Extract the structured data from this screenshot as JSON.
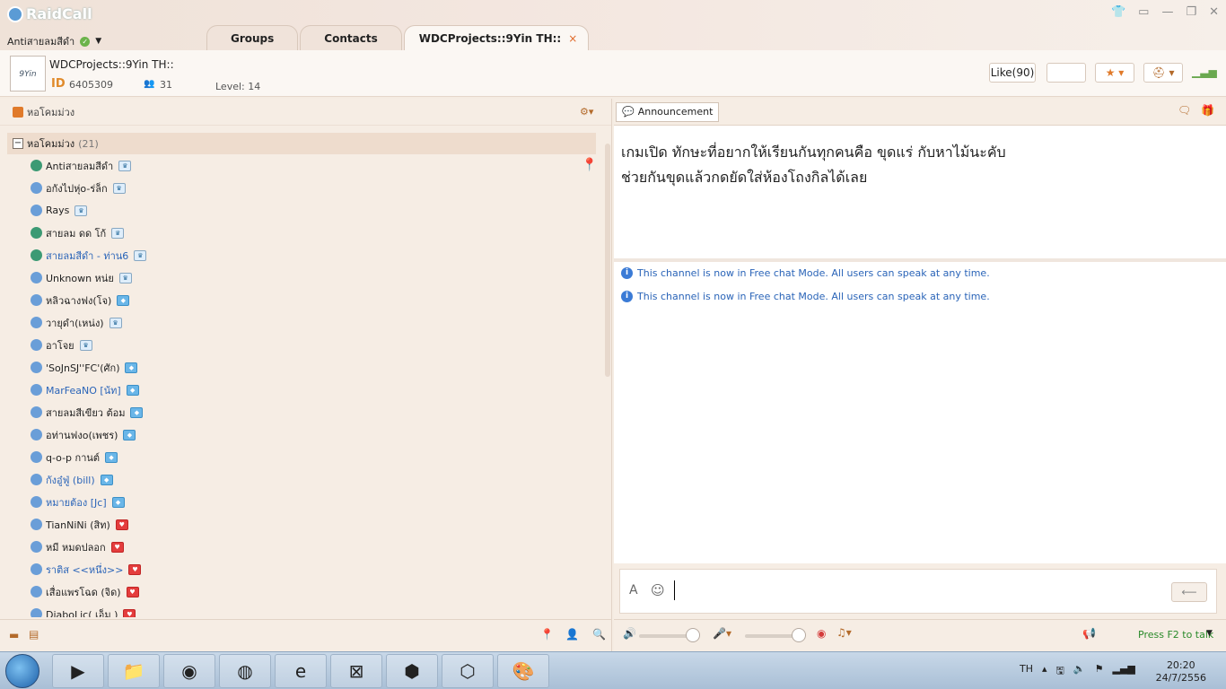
{
  "app": {
    "name": "RaidCall"
  },
  "user": {
    "name": "Antiสายลมสีดำ"
  },
  "tabs": [
    {
      "label": "Groups"
    },
    {
      "label": "Contacts"
    },
    {
      "label": "WDCProjects::9Yin TH::",
      "close": "×"
    }
  ],
  "window_controls": [
    "👕",
    "▭",
    "—",
    "❐",
    "✕"
  ],
  "channel": {
    "avatar_text": "9Yin",
    "name": "WDCProjects::9Yin TH::",
    "id_label": "ID",
    "id": "6405309",
    "member_count": "31",
    "level": "Level: 14"
  },
  "header_buttons": {
    "like": "Like(90)",
    "star": "★ ▾",
    "hat": "⛑ ▾",
    "signal": "▁▃▅"
  },
  "left": {
    "head_label": "หอโคมม่วง",
    "root": {
      "label": "หอโคมม่วง",
      "count": "(21)"
    },
    "members": [
      {
        "name": "Antiสายลมสีดำ",
        "icon": "green",
        "badge": "w",
        "color": "black"
      },
      {
        "name": "อกังไปหุ่o-ร่ล็ก",
        "icon": "blue",
        "badge": "w",
        "color": "black"
      },
      {
        "name": "Rays",
        "icon": "blue",
        "badge": "w",
        "color": "black"
      },
      {
        "name": "สายลม ดด  โก้",
        "icon": "green",
        "badge": "w",
        "color": "black"
      },
      {
        "name": "สายลมสีดำ - ท่าน6",
        "icon": "green",
        "badge": "w",
        "color": "blue"
      },
      {
        "name": "Unknown หน่ย",
        "icon": "blue",
        "badge": "w",
        "color": "black"
      },
      {
        "name": "หลิวฉางฟง(โจ)",
        "icon": "blue",
        "badge": "b",
        "color": "black"
      },
      {
        "name": "วายุดำ(เหน่ง)",
        "icon": "blue",
        "badge": "w",
        "color": "black"
      },
      {
        "name": "อาโจย",
        "icon": "blue",
        "badge": "w",
        "color": "black"
      },
      {
        "name": "'SoJnSJ''FC'(ศัก)",
        "icon": "blue",
        "badge": "b",
        "color": "black"
      },
      {
        "name": "MarFeaNO [น้ท]",
        "icon": "blue",
        "badge": "b",
        "color": "blue"
      },
      {
        "name": "สายลมสีเขียว   ต้อม",
        "icon": "blue",
        "badge": "b",
        "color": "black"
      },
      {
        "name": "อท่านฟงo(เพชร)",
        "icon": "blue",
        "badge": "b",
        "color": "black"
      },
      {
        "name": "q-o-p  กานต์",
        "icon": "blue",
        "badge": "b",
        "color": "black"
      },
      {
        "name": "กังอู๋ฟู่ (bill)",
        "icon": "blue",
        "badge": "b",
        "color": "blue"
      },
      {
        "name": "หมายต้อง [Jc]",
        "icon": "blue",
        "badge": "b",
        "color": "blue"
      },
      {
        "name": "TianNiNi (สิท)",
        "icon": "blue",
        "badge": "r",
        "color": "black"
      },
      {
        "name": "หมี หมดปลอก",
        "icon": "blue",
        "badge": "r",
        "color": "black"
      },
      {
        "name": "ราติส <<หนึ่ง>>",
        "icon": "blue",
        "badge": "r",
        "color": "blue"
      },
      {
        "name": "เสื่อแพรโฉด (จิด)",
        "icon": "blue",
        "badge": "r",
        "color": "black"
      },
      {
        "name": "DiaboLic( เอ็ม )",
        "icon": "blue",
        "badge": "r",
        "color": "black"
      }
    ]
  },
  "right": {
    "announcement_label": "Announcement",
    "announcement_lines": [
      "เกมเปิด  ทักษะที่อยากให้เรียนกันทุกคนคือ  ขุดแร่  กับหาไม้นะคับ",
      "ช่วยกันขุดแล้วกดยัดใส่ห้องโถงกิลได้เลย"
    ],
    "log": [
      "This channel is now in Free chat Mode. All users can speak at any time.",
      "This channel is now in Free chat Mode. All users can speak at any time."
    ],
    "send_icon": "⟵",
    "press_to_talk": "Press F2 to talk"
  },
  "taskbar": {
    "apps": [
      "▶",
      "📁",
      "◉",
      "◍",
      "e",
      "⊠",
      "⬢",
      "⬡",
      "🎨"
    ],
    "lang": "TH",
    "time": "20:20",
    "date": "24/7/2556"
  },
  "colors": {
    "accent": "#e07a2a",
    "link": "#2a64b8",
    "panel": "#f6ede4"
  }
}
